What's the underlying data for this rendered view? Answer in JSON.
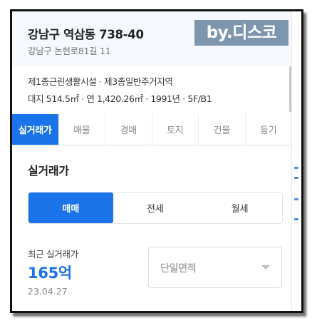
{
  "header": {
    "title": "강남구 역삼동 738-40",
    "subtitle": "강남구 논현로81길 11",
    "watermark": "by.디스코"
  },
  "info": {
    "zoning": "제1종근린생활시설 · 제3종일반주거지역",
    "specs": "대지 514.5㎡ · 연 1,420.26㎡ · 1991년 · 5F/B1"
  },
  "tabs": [
    {
      "label": "실거래가",
      "active": true
    },
    {
      "label": "매물",
      "active": false
    },
    {
      "label": "경매",
      "active": false
    },
    {
      "label": "토지",
      "active": false
    },
    {
      "label": "건물",
      "active": false
    },
    {
      "label": "등기",
      "active": false
    }
  ],
  "section": {
    "title": "실거래가"
  },
  "trade_types": [
    {
      "label": "매매",
      "active": true
    },
    {
      "label": "전세",
      "active": false
    },
    {
      "label": "월세",
      "active": false
    }
  ],
  "recent": {
    "label": "최근 실거래가",
    "price": "165억",
    "date": "23.04.27"
  },
  "unit_select": {
    "value": "단일면적"
  },
  "colors": {
    "accent": "#1a73e8",
    "header_bg": "#f5f8fc",
    "watermark_bg": "#7e96ad"
  }
}
